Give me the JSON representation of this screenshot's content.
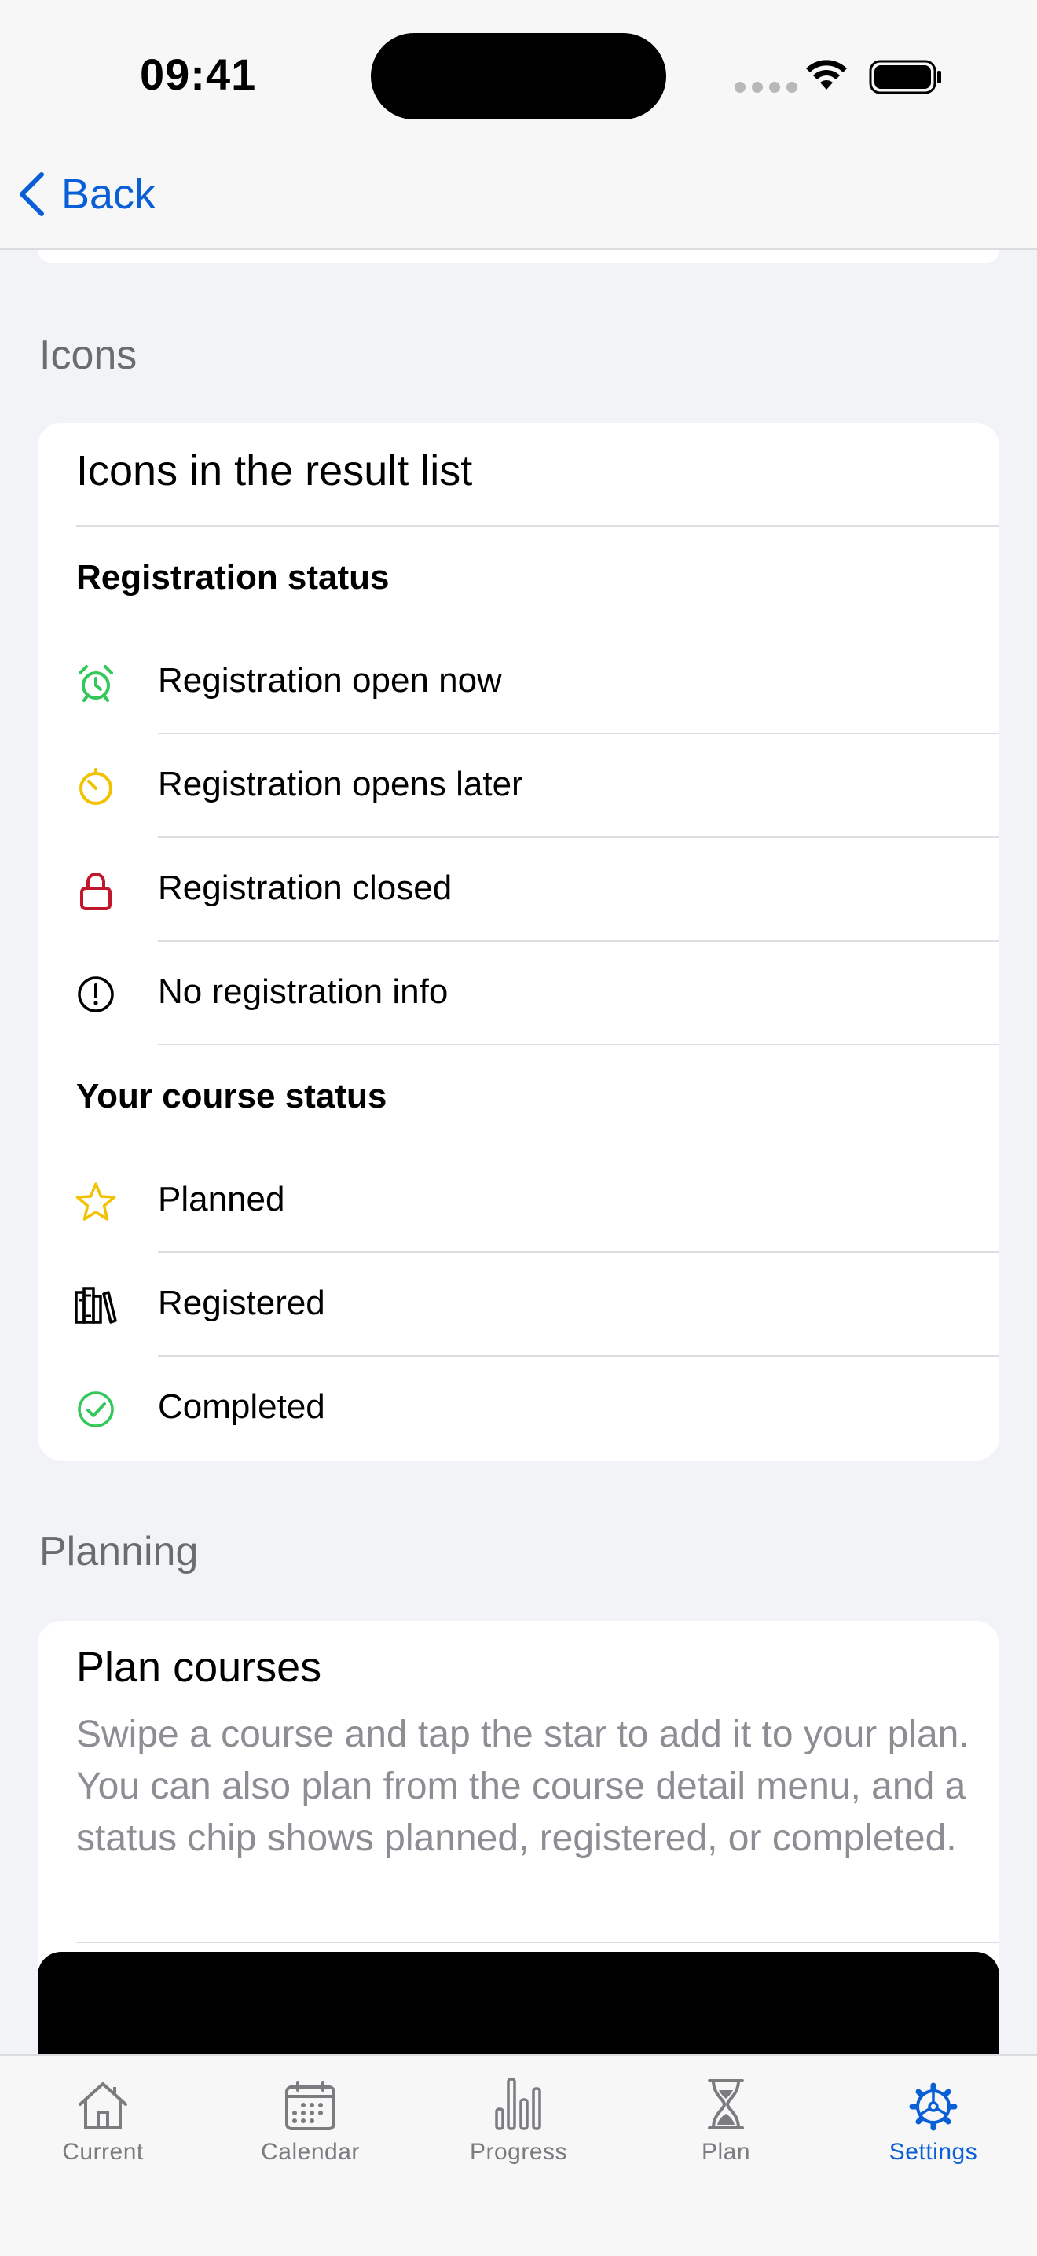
{
  "status_bar": {
    "time": "09:41"
  },
  "nav": {
    "back_label": "Back"
  },
  "icons_section": {
    "title": "Icons",
    "card_title": "Icons in the result list",
    "registration_heading": "Registration status",
    "registration_items": [
      {
        "label": "Registration open now",
        "icon": "alarm-clock-icon",
        "color": "#34c759"
      },
      {
        "label": "Registration opens later",
        "icon": "timer-icon",
        "color": "#f2c200"
      },
      {
        "label": "Registration closed",
        "icon": "lock-icon",
        "color": "#c0172c"
      },
      {
        "label": "No registration info",
        "icon": "exclamation-circle-icon",
        "color": "#000000"
      }
    ],
    "course_heading": "Your course status",
    "course_items": [
      {
        "label": "Planned",
        "icon": "star-icon",
        "color": "#f2c200"
      },
      {
        "label": "Registered",
        "icon": "books-icon",
        "color": "#000000"
      },
      {
        "label": "Completed",
        "icon": "checkmark-circle-icon",
        "color": "#34c759"
      }
    ]
  },
  "planning_section": {
    "title": "Planning",
    "card_title": "Plan courses",
    "description": "Swipe a course and tap the star to add it to your plan. You can also plan from the course detail menu, and a status chip shows planned, registered, or completed."
  },
  "tab_bar": {
    "tabs": [
      {
        "label": "Current",
        "icon": "house-icon",
        "active": false
      },
      {
        "label": "Calendar",
        "icon": "calendar-icon",
        "active": false
      },
      {
        "label": "Progress",
        "icon": "bar-chart-icon",
        "active": false
      },
      {
        "label": "Plan",
        "icon": "hourglass-icon",
        "active": false
      },
      {
        "label": "Settings",
        "icon": "gear-icon",
        "active": true
      }
    ]
  },
  "colors": {
    "accent": "#0a5fd6",
    "background": "#f2f3f7",
    "section_header": "#6b6c70"
  }
}
